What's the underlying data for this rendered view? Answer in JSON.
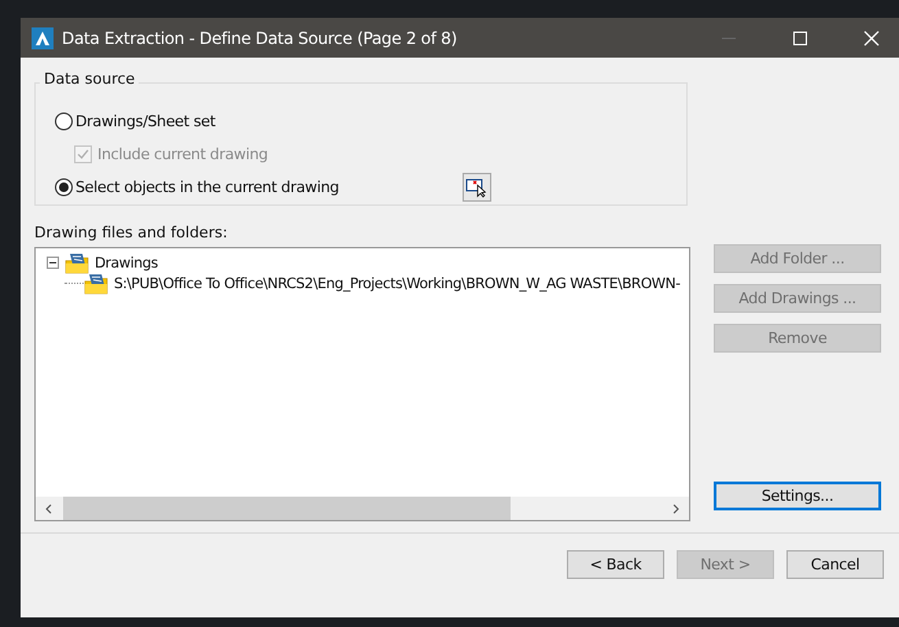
{
  "window": {
    "title": "Data Extraction - Define Data Source (Page 2 of 8)"
  },
  "data_source": {
    "label": "Data source",
    "options": [
      {
        "kind": "radio",
        "label": "Drawings/Sheet set",
        "selected": false
      },
      {
        "kind": "checkbox",
        "label": "Include current drawing",
        "checked": true,
        "disabled": true
      },
      {
        "kind": "radio",
        "label": "Select objects in the current drawing",
        "selected": true,
        "picker": true
      }
    ]
  },
  "files": {
    "label": "Drawing files and folders:",
    "tree": [
      {
        "label": "Drawings",
        "expanded": true,
        "children": [
          {
            "label": "S:\\PUB\\Office To Office\\NRCS2\\Eng_Projects\\Working\\BROWN_W_AG WASTE\\BROWN-"
          }
        ]
      }
    ]
  },
  "side_buttons": [
    {
      "label": "Add Folder ...",
      "disabled": true
    },
    {
      "label": "Add Drawings ...",
      "disabled": true
    },
    {
      "label": "Remove",
      "disabled": true
    }
  ],
  "settings_button": {
    "label": "Settings...",
    "focused": true
  },
  "footer_buttons": [
    {
      "label": "< Back",
      "disabled": false
    },
    {
      "label": "Next >",
      "disabled": true
    },
    {
      "label": "Cancel",
      "disabled": false
    }
  ]
}
